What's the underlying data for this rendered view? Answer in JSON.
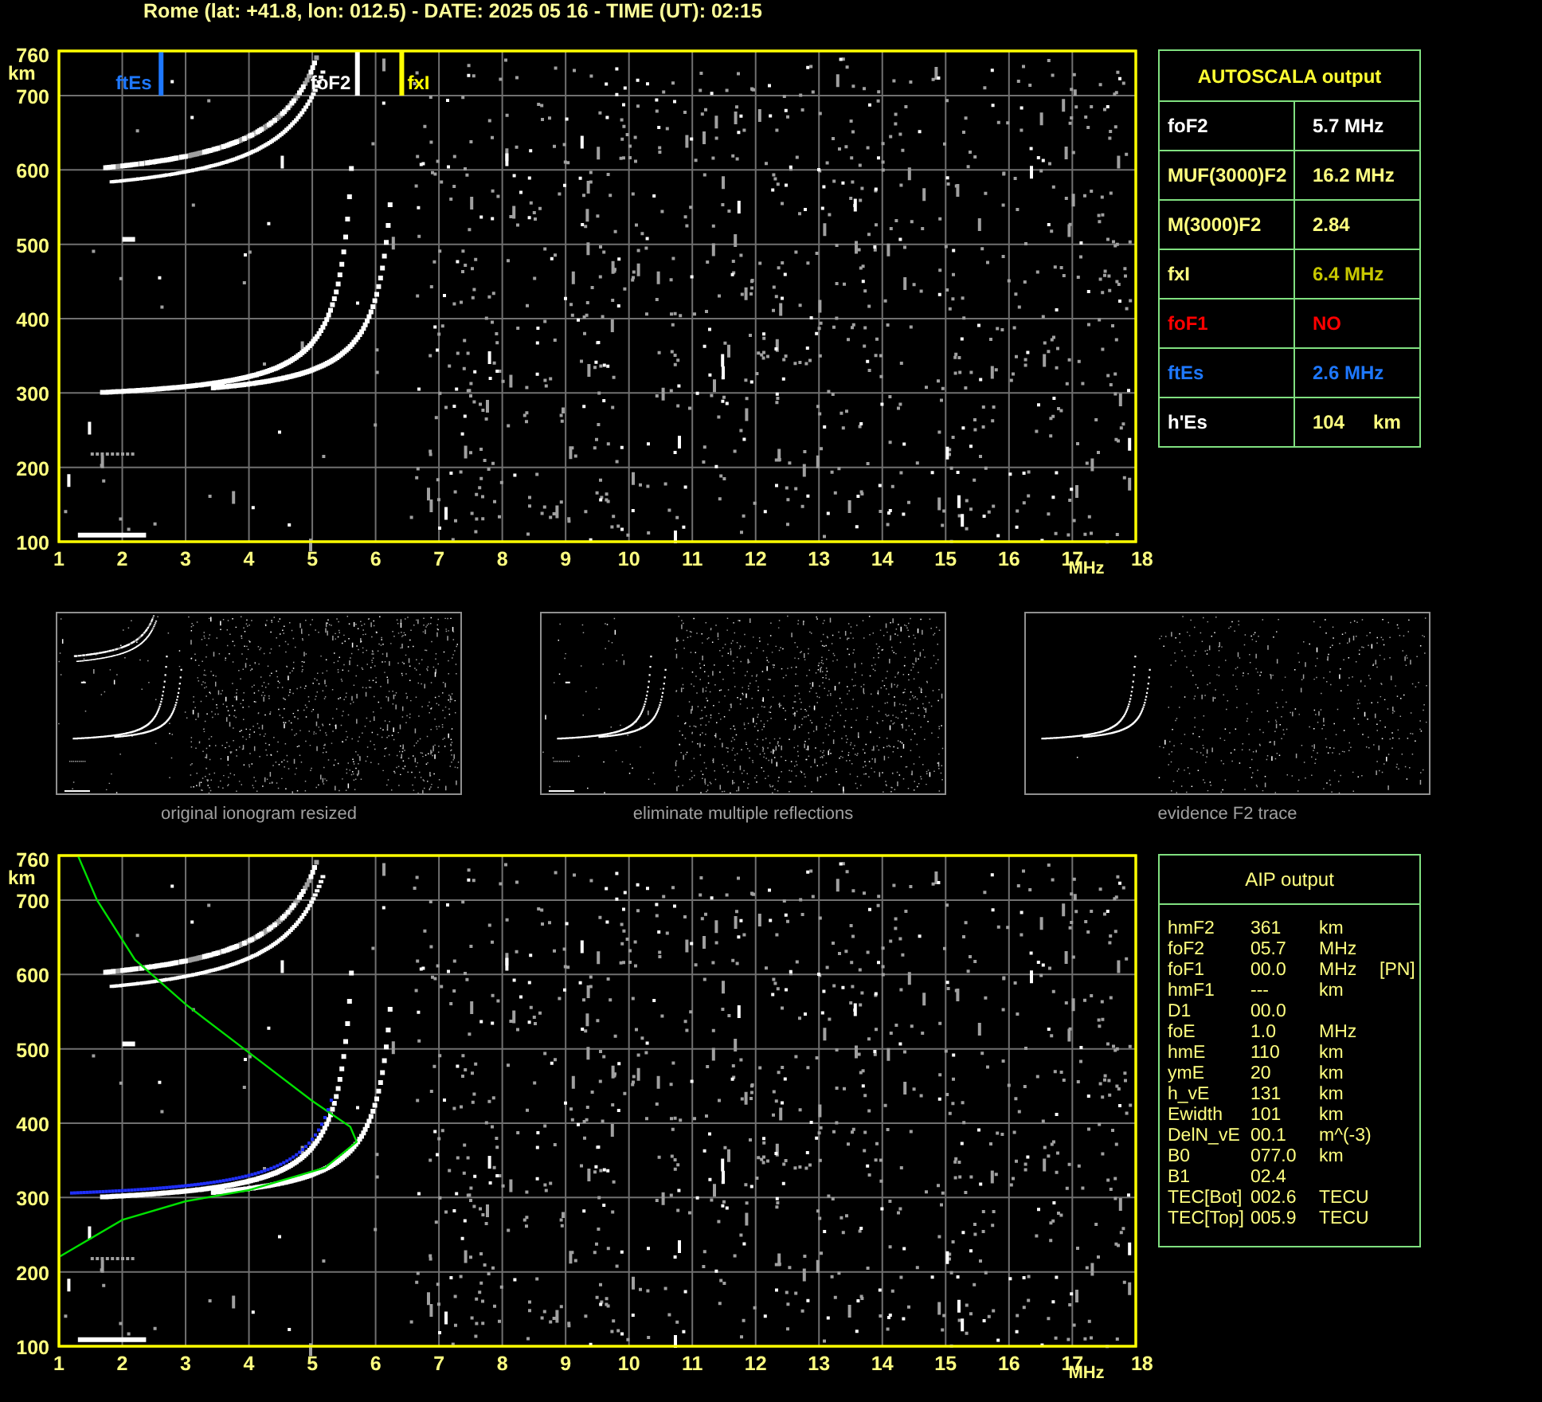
{
  "header": {
    "title": "Rome (lat: +41.8, lon: 012.5) - DATE: 2025 05 16 - TIME (UT): 02:15"
  },
  "ionograms": [
    {
      "y_ticks": [
        "760",
        "700",
        "600",
        "500",
        "400",
        "300",
        "200",
        "100"
      ],
      "y_unit": "km",
      "x_ticks": [
        "1",
        "2",
        "3",
        "4",
        "5",
        "6",
        "7",
        "8",
        "9",
        "10",
        "11",
        "12",
        "13",
        "14",
        "15",
        "16",
        "17",
        "18"
      ],
      "x_unit": "MHz",
      "markers": [
        {
          "label": "ftEs",
          "color": "#1e78ff"
        },
        {
          "label": "foF2",
          "color": "#ffffff"
        },
        {
          "label": "fxI",
          "color": "#ffff00"
        }
      ]
    },
    {
      "y_ticks": [
        "760",
        "700",
        "600",
        "500",
        "400",
        "300",
        "200",
        "100"
      ],
      "y_unit": "km",
      "x_ticks": [
        "1",
        "2",
        "3",
        "4",
        "5",
        "6",
        "7",
        "8",
        "9",
        "10",
        "11",
        "12",
        "13",
        "14",
        "15",
        "16",
        "17",
        "18"
      ],
      "x_unit": "MHz",
      "profile_fit": true
    }
  ],
  "autoscala": {
    "title": "AUTOSCALA output",
    "rows": [
      {
        "name": "foF2",
        "color": "#ffffff",
        "value": {
          "text": "5.7 MHz",
          "color": "#ffffff"
        }
      },
      {
        "name": "MUF(3000)F2",
        "color": "#ffff80",
        "value": {
          "text": "16.2 MHz",
          "color": "#ffff80"
        }
      },
      {
        "name": "M(3000)F2",
        "color": "#ffff80",
        "value": {
          "text": "2.84",
          "color": "#ffff80"
        }
      },
      {
        "name": "fxI",
        "color": "#ffff80",
        "value": {
          "text": "6.4 MHz",
          "color": "#c8c800"
        }
      },
      {
        "name": "foF1",
        "color": "#ff0000",
        "value": {
          "text": "NO",
          "color": "#ff0000"
        }
      },
      {
        "name": "ftEs",
        "color": "#1e78ff",
        "value": {
          "text": "2.6 MHz",
          "color": "#1e78ff"
        }
      },
      {
        "name": "h'Es",
        "color": "#ffffff",
        "value": {
          "text": "104",
          "unit": "km",
          "color": "#ffff80"
        }
      }
    ]
  },
  "thumbnails": [
    {
      "caption": "original ionogram resized"
    },
    {
      "caption": "eliminate multiple reflections"
    },
    {
      "caption": "evidence F2 trace"
    }
  ],
  "aip": {
    "title": "AIP output",
    "rows": [
      {
        "name": "hmF2",
        "value": "361",
        "unit": "km"
      },
      {
        "name": "foF2",
        "value": "05.7",
        "unit": "MHz"
      },
      {
        "name": "foF1",
        "value": "00.0",
        "unit": "MHz",
        "note": "[PN]"
      },
      {
        "name": "hmF1",
        "value": "---",
        "unit": "km"
      },
      {
        "name": "D1",
        "value": "00.0"
      },
      {
        "name": "foE",
        "value": "1.0",
        "unit": "MHz"
      },
      {
        "name": "hmE",
        "value": "110",
        "unit": "km"
      },
      {
        "name": "ymE",
        "value": "20",
        "unit": "km"
      },
      {
        "name": "h_vE",
        "value": "131",
        "unit": "km"
      },
      {
        "name": "Ewidth",
        "value": "101",
        "unit": "km"
      },
      {
        "name": "DelN_vE",
        "value": "00.1",
        "unit": "m^(-3)"
      },
      {
        "name": "B0",
        "value": "077.0",
        "unit": "km"
      },
      {
        "name": "B1",
        "value": "02.4"
      },
      {
        "name": "TEC[Bot]",
        "value": "002.6",
        "unit": "TECU"
      },
      {
        "name": "TEC[Top]",
        "value": "005.9",
        "unit": "TECU"
      }
    ]
  }
}
